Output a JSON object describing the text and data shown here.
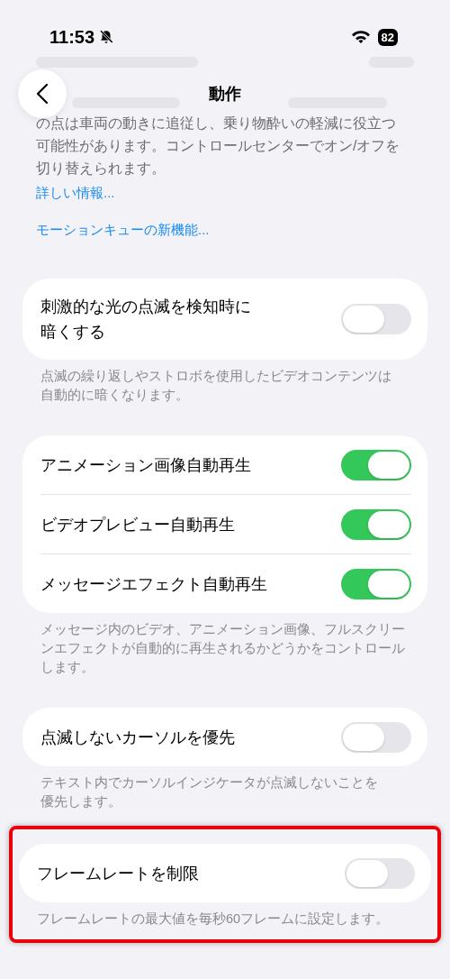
{
  "status_bar": {
    "time": "11:53",
    "battery": "82"
  },
  "nav": {
    "title": "動作"
  },
  "intro": {
    "lines": [
      "の点は車両の動きに追従し、乗り物酔いの軽減に役立つ",
      "可能性があります。コントロールセンターでオン/オフを",
      "切り替えられます。"
    ],
    "links": [
      "詳しい情報...",
      "モーションキューの新機能..."
    ]
  },
  "groups": [
    {
      "highlighted": false,
      "rows": [
        {
          "label_lines": [
            "刺激的な光の点滅を検知時に",
            "暗くする"
          ],
          "on": false
        }
      ],
      "footer_lines": [
        "点滅の繰り返しやストロボを使用したビデオコンテンツは",
        "自動的に暗くなります。"
      ]
    },
    {
      "highlighted": false,
      "rows": [
        {
          "label_lines": [
            "アニメーション画像自動再生"
          ],
          "on": true
        },
        {
          "label_lines": [
            "ビデオプレビュー自動再生"
          ],
          "on": true
        },
        {
          "label_lines": [
            "メッセージエフェクト自動再生"
          ],
          "on": true
        }
      ],
      "footer_lines": [
        "メッセージ内のビデオ、アニメーション画像、フルスクリー",
        "ンエフェクトが自動的に再生されるかどうかをコントロール",
        "します。"
      ]
    },
    {
      "highlighted": false,
      "rows": [
        {
          "label_lines": [
            "点滅しないカーソルを優先"
          ],
          "on": false
        }
      ],
      "footer_lines": [
        "テキスト内でカーソルインジケータが点滅しないことを",
        "優先します。"
      ]
    },
    {
      "highlighted": true,
      "rows": [
        {
          "label_lines": [
            "フレームレートを制限"
          ],
          "on": false
        }
      ],
      "footer_lines": [
        "フレームレートの最大値を毎秒60フレームに設定します。"
      ]
    }
  ]
}
